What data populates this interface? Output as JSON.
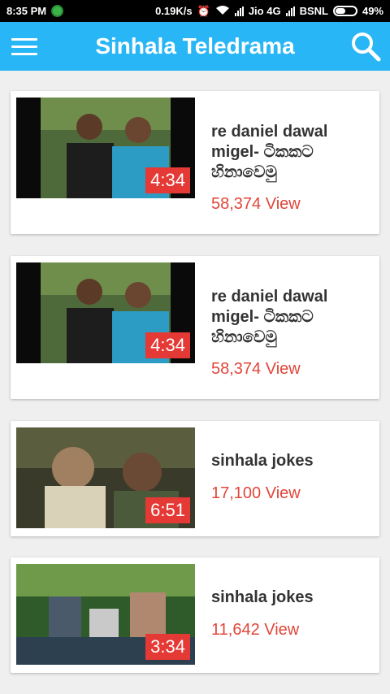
{
  "status_bar": {
    "time": "8:35 PM",
    "speed": "0.19K/s",
    "carrier1": "Jio 4G",
    "carrier2": "BSNL",
    "battery": "49%"
  },
  "app_bar": {
    "title": "Sinhala Teledrama",
    "menu_icon": "hamburger-menu-icon",
    "search_icon": "search-icon",
    "color": "#29b6f6"
  },
  "videos": [
    {
      "title": "re daniel dawal migel- ටිකකට හිනාවෙමු",
      "views": "58,374 View",
      "duration": "4:34"
    },
    {
      "title": "re daniel dawal migel- ටිකකට හිනාවෙමු",
      "views": "58,374 View",
      "duration": "4:34"
    },
    {
      "title": "sinhala jokes",
      "views": "17,100 View",
      "duration": "6:51"
    },
    {
      "title": "sinhala jokes",
      "views": "11,642 View",
      "duration": "3:34"
    }
  ],
  "colors": {
    "accent": "#29b6f6",
    "views": "#e0463a",
    "duration_badge": "#e53935"
  }
}
